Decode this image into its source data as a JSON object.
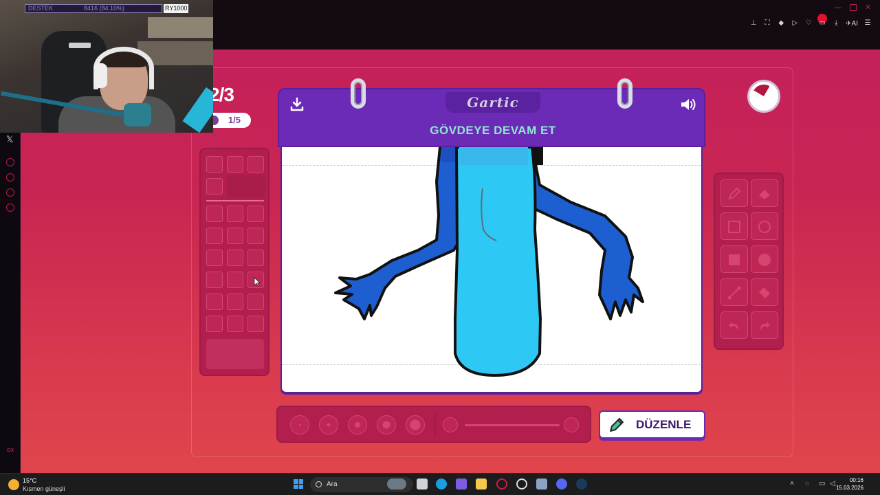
{
  "stream_overlay": {
    "label": "DESTEK",
    "value": "8416 (84.10%)",
    "tag": "RY1000"
  },
  "game": {
    "round": "2/3",
    "sub_round": "1/5",
    "brand": "Gartic",
    "instruction": "GÖVDEYE DEVAM ET",
    "edit_label": "DÜZENLE",
    "timer_remaining_fraction": 0.75
  },
  "tools": {
    "items": [
      "pencil-icon",
      "eraser-icon",
      "rectangle-outline-icon",
      "circle-outline-icon",
      "rectangle-fill-icon",
      "circle-fill-icon",
      "line-icon",
      "fill-bucket-icon",
      "undo-icon",
      "redo-icon"
    ]
  },
  "brush": {
    "sizes": [
      "size-1",
      "size-2",
      "size-3",
      "size-4",
      "size-5"
    ]
  },
  "sidebar": {
    "label": "GX"
  },
  "taskbar": {
    "weather_temp": "15°C",
    "weather_desc": "Kısmen güneşli",
    "search_placeholder": "Ara",
    "time": "00:16",
    "date": "15.03.2026"
  },
  "colors": {
    "accent": "#6b2bb7",
    "title_text": "#8fe6d2",
    "page_bg": "#c92552",
    "drawing_blue": "#1d5fd0",
    "drawing_cyan": "#2ec8f5"
  }
}
